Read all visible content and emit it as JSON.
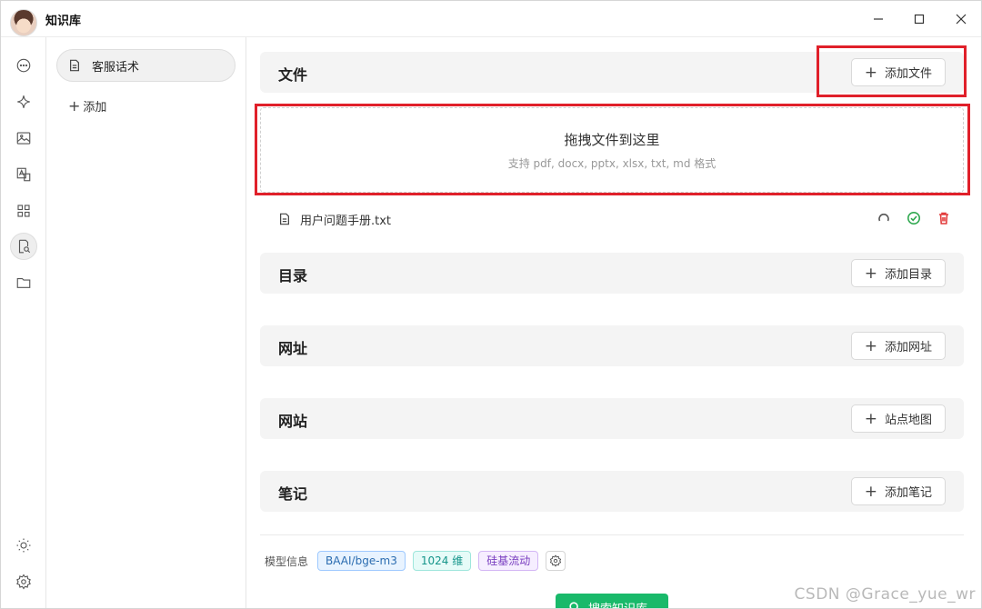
{
  "app": {
    "title": "知识库"
  },
  "kb_list": {
    "items": [
      {
        "label": "客服话术"
      }
    ],
    "add_label": "添加"
  },
  "sections": {
    "files": {
      "title": "文件",
      "button": "添加文件"
    },
    "dropzone": {
      "title": "拖拽文件到这里",
      "subtitle": "支持 pdf, docx, pptx, xlsx, txt, md 格式"
    },
    "file_list": [
      {
        "name": "用户问题手册.txt"
      }
    ],
    "directory": {
      "title": "目录",
      "button": "添加目录"
    },
    "url": {
      "title": "网址",
      "button": "添加网址"
    },
    "website": {
      "title": "网站",
      "button": "站点地图"
    },
    "notes": {
      "title": "笔记",
      "button": "添加笔记"
    }
  },
  "model_info": {
    "label": "模型信息",
    "model": "BAAI/bge-m3",
    "dimensions": "1024 维",
    "provider": "硅基流动"
  },
  "search_button": "搜索知识库",
  "watermark": "CSDN @Grace_yue_wr",
  "colors": {
    "highlight_box": "#e0202a",
    "primary_green": "#19b96a",
    "success": "#2fa84f",
    "danger": "#e23b3b"
  },
  "icons": {
    "rail": [
      "chat-icon",
      "sparkle-icon",
      "image-icon",
      "translate-icon",
      "apps-icon",
      "knowledge-search-icon",
      "folder-icon",
      "theme-sun-icon",
      "settings-icon"
    ]
  }
}
